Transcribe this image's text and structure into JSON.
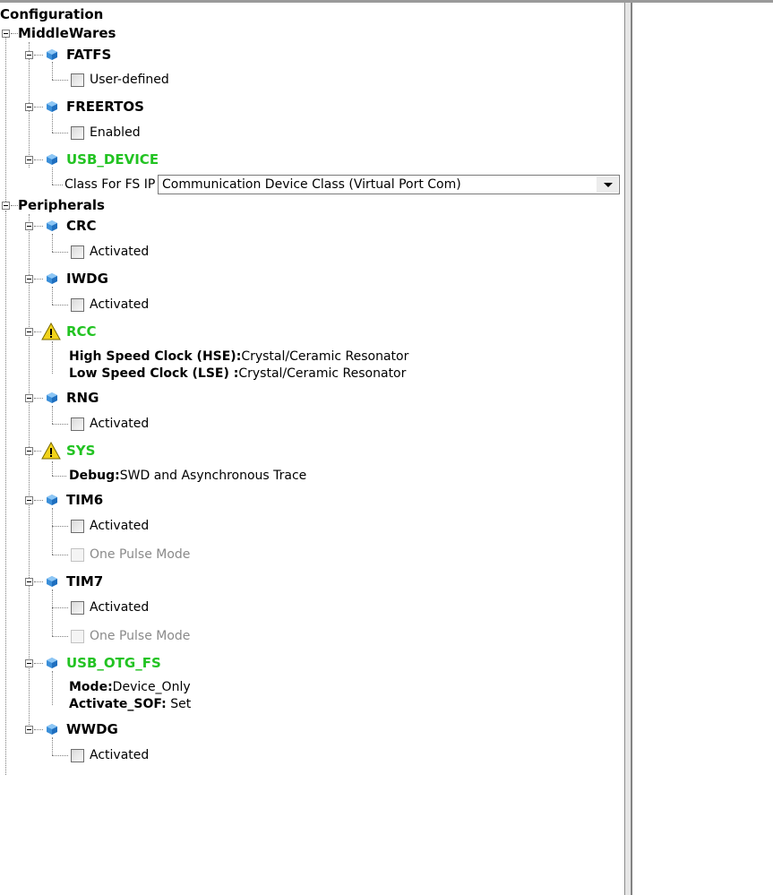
{
  "root_label": "Configuration",
  "middlewares": {
    "label": "MiddleWares",
    "fatfs": {
      "label": "FATFS",
      "option": "User-defined"
    },
    "freertos": {
      "label": "FREERTOS",
      "option": "Enabled"
    },
    "usb_device": {
      "label": "USB_DEVICE",
      "class_label": "Class For FS IP",
      "class_value": "Communication Device Class (Virtual Port Com)"
    }
  },
  "peripherals": {
    "label": "Peripherals",
    "crc": {
      "label": "CRC",
      "option": "Activated"
    },
    "iwdg": {
      "label": "IWDG",
      "option": "Activated"
    },
    "rcc": {
      "label": "RCC",
      "hse_key": "High Speed Clock (HSE):",
      "hse_value": "Crystal/Ceramic Resonator",
      "lse_key": "Low Speed Clock (LSE) :",
      "lse_value": "Crystal/Ceramic Resonator"
    },
    "rng": {
      "label": "RNG",
      "option": "Activated"
    },
    "sys": {
      "label": "SYS",
      "debug_key": "Debug:",
      "debug_value": "SWD and Asynchronous Trace"
    },
    "tim6": {
      "label": "TIM6",
      "option1": "Activated",
      "option2": "One Pulse Mode"
    },
    "tim7": {
      "label": "TIM7",
      "option1": "Activated",
      "option2": "One Pulse Mode"
    },
    "usb_otg_fs": {
      "label": "USB_OTG_FS",
      "mode_key": "Mode:",
      "mode_value": "Device_Only",
      "sof_key": "Activate_SOF:",
      "sof_value": " Set"
    },
    "wwdg": {
      "label": "WWDG",
      "option": "Activated"
    }
  },
  "colors": {
    "configured": "#22c322",
    "tree_line": "#808080",
    "icon_blue": "#3b8fd9",
    "warning": "#f2d31b"
  }
}
